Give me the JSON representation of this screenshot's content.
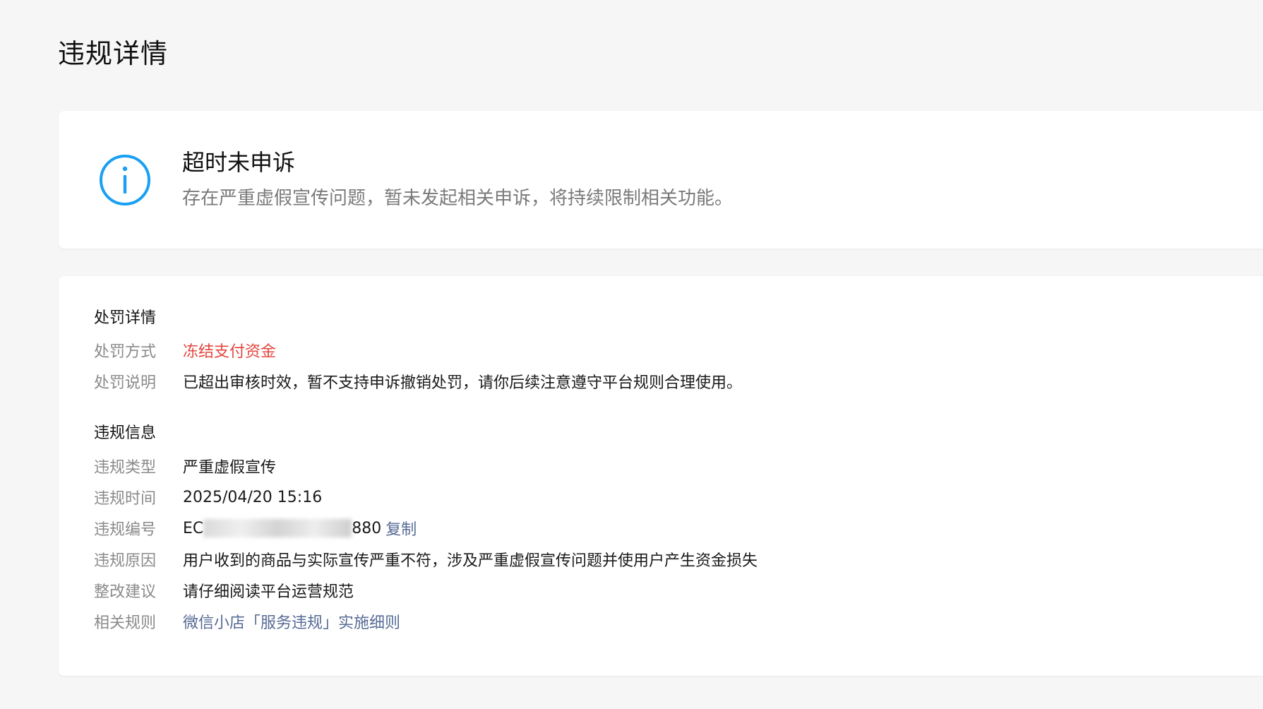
{
  "page": {
    "title": "违规详情"
  },
  "status": {
    "icon": "info-icon",
    "icon_color": "#1aa0f2",
    "title": "超时未申诉",
    "description": "存在严重虚假宣传问题，暂未发起相关申诉，将持续限制相关功能。"
  },
  "penalty": {
    "section_title": "处罚详情",
    "method_label": "处罚方式",
    "method_value": "冻结支付资金",
    "method_color": "#e5453c",
    "note_label": "处罚说明",
    "note_value": "已超出审核时效，暂不支持申诉撤销处罚，请你后续注意遵守平台规则合理使用。"
  },
  "violation": {
    "section_title": "违规信息",
    "type_label": "违规类型",
    "type_value": "严重虚假宣传",
    "time_label": "违规时间",
    "time_value": "2025/04/20 15:16",
    "id_label": "违规编号",
    "id_prefix": "EC",
    "id_suffix": "880",
    "copy_label": "复制",
    "reason_label": "违规原因",
    "reason_value": "用户收到的商品与实际宣传严重不符，涉及严重虚假宣传问题并使用户产生资金损失",
    "advice_label": "整改建议",
    "advice_value": "请仔细阅读平台运营规范",
    "rule_label": "相关规则",
    "rule_value": "微信小店「服务违规」实施细则",
    "link_color": "#576b95"
  }
}
